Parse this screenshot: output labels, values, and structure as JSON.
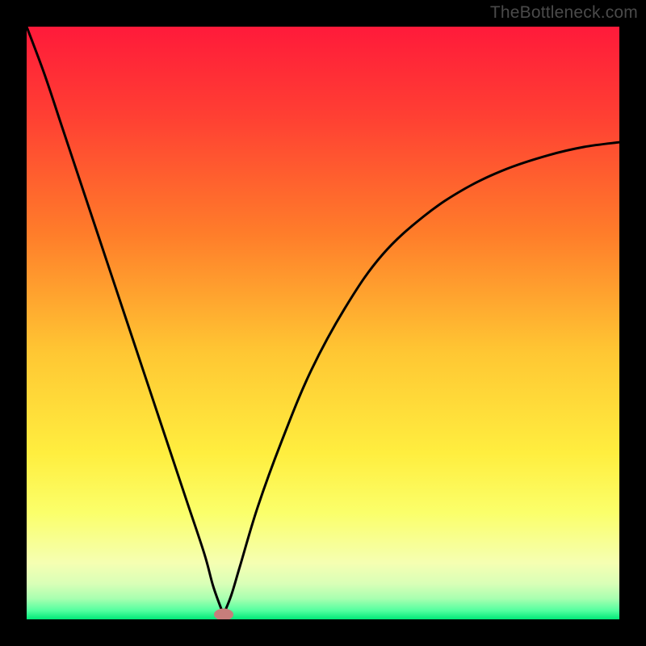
{
  "watermark": {
    "text": "TheBottleneck.com"
  },
  "colors": {
    "black": "#000000",
    "curve_stroke": "#000000",
    "blob": "#c77e7b",
    "gradient_stops": [
      {
        "offset": 0.0,
        "color": "#ff1a3a"
      },
      {
        "offset": 0.15,
        "color": "#ff3f33"
      },
      {
        "offset": 0.35,
        "color": "#ff7d2a"
      },
      {
        "offset": 0.55,
        "color": "#ffc733"
      },
      {
        "offset": 0.72,
        "color": "#ffee3f"
      },
      {
        "offset": 0.82,
        "color": "#fbff6a"
      },
      {
        "offset": 0.905,
        "color": "#f5ffb2"
      },
      {
        "offset": 0.94,
        "color": "#d9ffb7"
      },
      {
        "offset": 0.965,
        "color": "#a8ffb0"
      },
      {
        "offset": 0.985,
        "color": "#54ffa0"
      },
      {
        "offset": 1.0,
        "color": "#00e878"
      }
    ]
  },
  "chart_data": {
    "type": "line",
    "title": "",
    "xlabel": "",
    "ylabel": "",
    "x_range": [
      0,
      100
    ],
    "y_range": [
      0,
      100
    ],
    "optimum_x": 33.2,
    "series": [
      {
        "name": "bottleneck-curve",
        "x": [
          0,
          3,
          6,
          9,
          12,
          15,
          18,
          21,
          24,
          27,
          30,
          31.5,
          33.2,
          34.5,
          36,
          39,
          43,
          48,
          54,
          60,
          67,
          74,
          81,
          88,
          94,
          100
        ],
        "y": [
          100,
          92,
          83,
          74,
          65,
          56,
          47,
          38,
          29,
          20,
          11,
          5.5,
          0.8,
          4,
          9,
          19,
          30,
          42,
          53,
          61.5,
          68,
          72.7,
          76,
          78.3,
          79.7,
          80.5
        ]
      }
    ],
    "annotations": [
      {
        "name": "optimum-marker",
        "x": 33.2,
        "y": 0.8
      }
    ]
  }
}
